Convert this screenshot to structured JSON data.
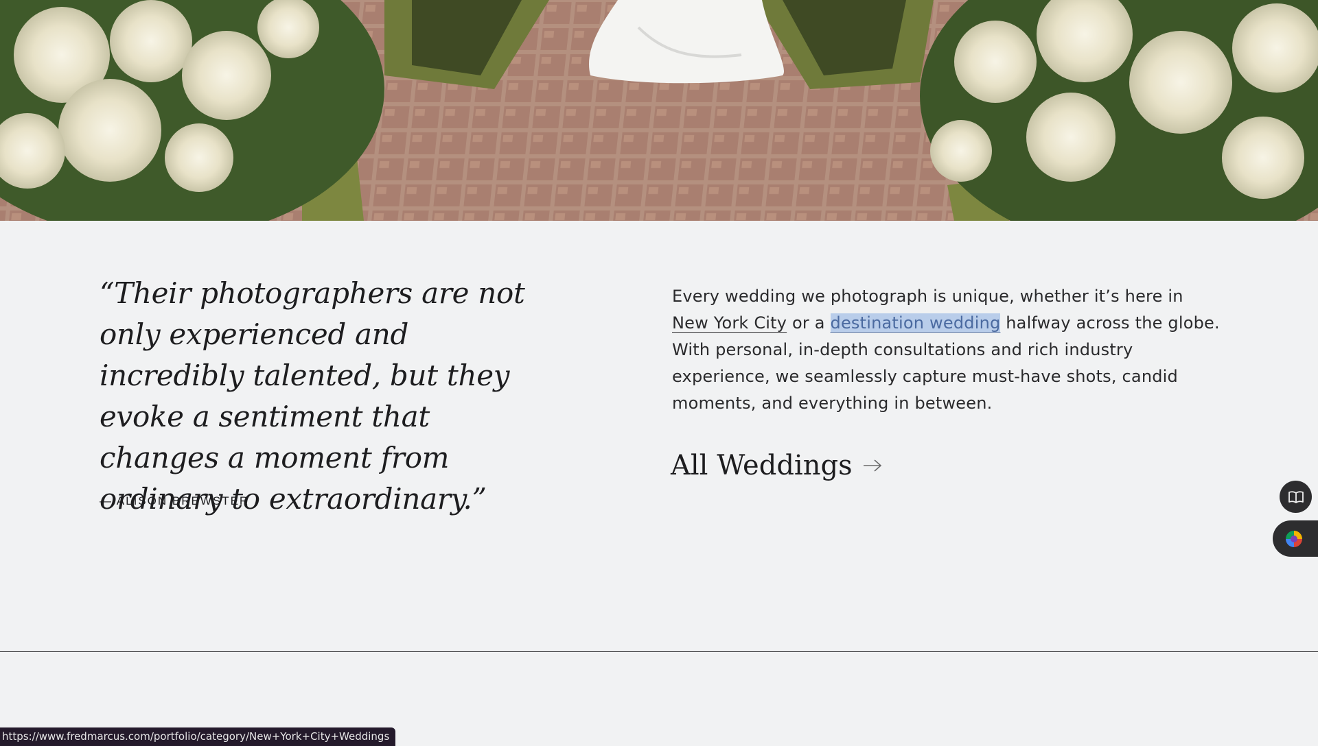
{
  "hero": {
    "alt": "Bride walking along a tiled garden path between hedges and white hydrangeas"
  },
  "quote": {
    "text": "“Their photographers are not only experienced and incredibly talented, but they evoke a sentiment that changes a moment from ordinary to extraordinary.”",
    "attribution": "— ALISON BREWSTER"
  },
  "copy": {
    "part1": "Every wedding we photograph is unique, whether it’s here in ",
    "link_nyc": "New York City",
    "part2": " or a ",
    "link_destination": "destination wedding",
    "part3": " halfway across the globe. With personal, in-depth consultations and rich industry experience, we seamlessly capture must-have shots, candid moments, and everything in between."
  },
  "cta": {
    "label": "All Weddings",
    "icon": "arrow-right-icon"
  },
  "widgets": {
    "reader_icon": "book-icon",
    "color_icon": "color-picker-icon"
  },
  "statusbar": {
    "url": "https://www.fredmarcus.com/portfolio/category/New+York+City+Weddings"
  },
  "colors": {
    "background": "#f1f2f3",
    "text": "#1d1d1f",
    "highlight": "#b9cdea",
    "statusbar": "#241a2b"
  }
}
